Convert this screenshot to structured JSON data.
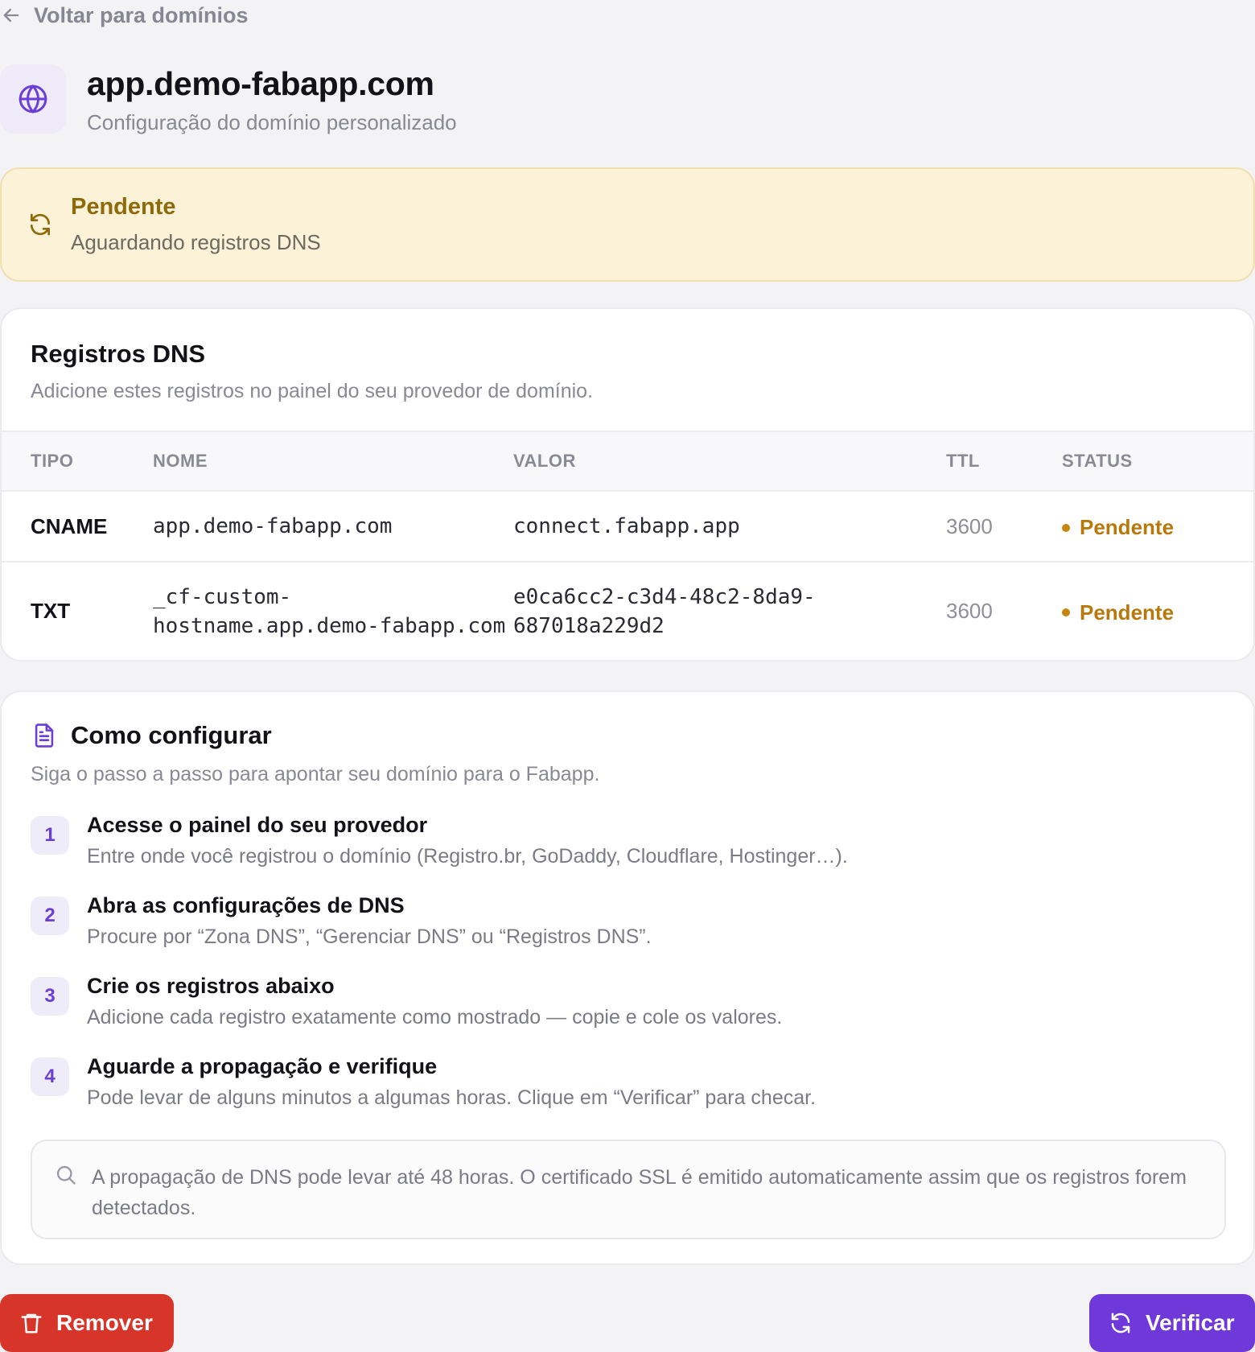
{
  "nav": {
    "back_label": "Voltar para domínios"
  },
  "domain": {
    "name": "app.demo-fabapp.com",
    "subtitle": "Configuração do domínio personalizado"
  },
  "status": {
    "title": "Pendente",
    "description": "Aguardando registros DNS"
  },
  "dns": {
    "title": "Registros DNS",
    "subtitle": "Adicione estes registros no painel do seu provedor de domínio.",
    "columns": [
      "TIPO",
      "NOME",
      "VALOR",
      "TTL",
      "STATUS"
    ],
    "rows": [
      {
        "type": "CNAME",
        "name_lines": [
          "app.demo-fabapp.com"
        ],
        "value_lines": [
          "connect.fabapp.app"
        ],
        "ttl": "3600",
        "status": "Pendente"
      },
      {
        "type": "TXT",
        "name_lines": [
          "_cf-custom-",
          "hostname.app.demo-fabapp.com"
        ],
        "value_lines": [
          "e0ca6cc2-c3d4-48c2-8da9-",
          "687018a229d2"
        ],
        "ttl": "3600",
        "status": "Pendente"
      }
    ]
  },
  "howto": {
    "title": "Como configurar",
    "subtitle": "Siga o passo a passo para apontar seu domínio para o Fabapp.",
    "steps": [
      {
        "number": "1",
        "title": "Acesse o painel do seu provedor",
        "description": "Entre onde você registrou o domínio (Registro.br, GoDaddy, Cloudflare, Hostinger…)."
      },
      {
        "number": "2",
        "title": "Abra as configurações de DNS",
        "description": "Procure por “Zona DNS”, “Gerenciar DNS” ou “Registros DNS”."
      },
      {
        "number": "3",
        "title": "Crie os registros abaixo",
        "description": "Adicione cada registro exatamente como mostrado — copie e cole os valores."
      },
      {
        "number": "4",
        "title": "Aguarde a propagação e verifique",
        "description": "Pode levar de alguns minutos a algumas horas. Clique em “Verificar” para checar."
      }
    ],
    "note": "A propagação de DNS pode levar até 48 horas. O certificado SSL é emitido automaticamente assim que os registros forem detectados."
  },
  "actions": {
    "remove_label": "Remover",
    "verify_label": "Verificar"
  },
  "colors": {
    "accent": "#6f38d8",
    "danger": "#d8352a",
    "pending": "#b8780c",
    "banner_bg": "#fcf2d8"
  },
  "icons": {
    "back": "arrow-left-icon",
    "domain": "globe-icon",
    "status": "refresh-icon",
    "howto": "document-icon",
    "note": "search-icon",
    "remove": "trash-icon",
    "verify": "refresh-icon"
  }
}
